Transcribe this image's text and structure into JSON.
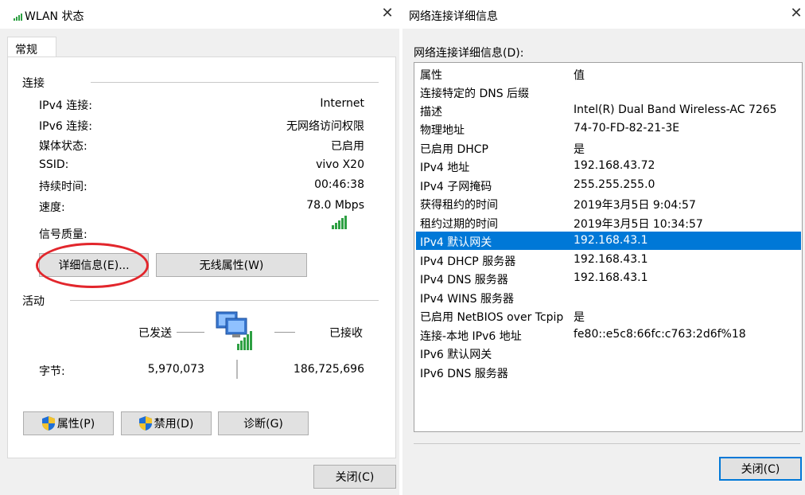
{
  "left_window": {
    "title": "WLAN 状态",
    "tab": "常规",
    "connection_section": "连接",
    "rows": [
      {
        "label": "IPv4 连接:",
        "value": "Internet"
      },
      {
        "label": "IPv6 连接:",
        "value": "无网络访问权限"
      },
      {
        "label": "媒体状态:",
        "value": "已启用"
      },
      {
        "label": "SSID:",
        "value": "vivo X20"
      },
      {
        "label": "持续时间:",
        "value": "00:46:38"
      },
      {
        "label": "速度:",
        "value": "78.0 Mbps"
      }
    ],
    "signal_label": "信号质量:",
    "details_button": "详细信息(E)...",
    "wireless_button": "无线属性(W)",
    "activity_section": "活动",
    "sent_label": "已发送",
    "received_label": "已接收",
    "bytes_label": "字节:",
    "bytes_sent": "5,970,073",
    "bytes_received": "186,725,696",
    "properties_button": "属性(P)",
    "disable_button": "禁用(D)",
    "diagnose_button": "诊断(G)",
    "close_button": "关闭(C)"
  },
  "right_window": {
    "title": "网络连接详细信息",
    "list_label": "网络连接详细信息(D):",
    "header": {
      "property": "属性",
      "value": "值"
    },
    "rows": [
      {
        "property": "连接特定的 DNS 后缀",
        "value": ""
      },
      {
        "property": "描述",
        "value": "Intel(R) Dual Band Wireless-AC 7265"
      },
      {
        "property": "物理地址",
        "value": "74-70-FD-82-21-3E"
      },
      {
        "property": "已启用 DHCP",
        "value": "是"
      },
      {
        "property": "IPv4 地址",
        "value": "192.168.43.72"
      },
      {
        "property": "IPv4 子网掩码",
        "value": "255.255.255.0"
      },
      {
        "property": "获得租约的时间",
        "value": "2019年3月5日 9:04:57"
      },
      {
        "property": "租约过期的时间",
        "value": "2019年3月5日 10:34:57"
      },
      {
        "property": "IPv4 默认网关",
        "value": "192.168.43.1"
      },
      {
        "property": "IPv4 DHCP 服务器",
        "value": "192.168.43.1"
      },
      {
        "property": "IPv4 DNS 服务器",
        "value": "192.168.43.1"
      },
      {
        "property": "IPv4 WINS 服务器",
        "value": ""
      },
      {
        "property": "已启用 NetBIOS over Tcpip",
        "value": "是"
      },
      {
        "property": "连接-本地 IPv6 地址",
        "value": "fe80::e5c8:66fc:c763:2d6f%18"
      },
      {
        "property": "IPv6 默认网关",
        "value": ""
      },
      {
        "property": "IPv6 DNS 服务器",
        "value": ""
      }
    ],
    "selected_index": 8,
    "close_button": "关闭(C)"
  },
  "colors": {
    "selection": "#0078d7",
    "highlight_circle": "#e2262c",
    "signal": "#2ea043"
  }
}
